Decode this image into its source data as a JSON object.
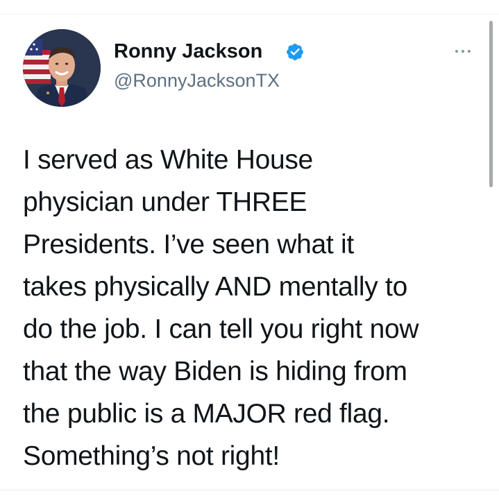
{
  "tweet": {
    "display_name": "Ronny Jackson",
    "handle": "@RonnyJacksonTX",
    "verified": true,
    "text": "I served as White House\nphysician under THREE\nPresidents. I’ve seen what it\ntakes physically AND mentally to\ndo the job. I can tell you right now\nthat the way Biden is hiding from\nthe public is a MAJOR red flag.\nSomething’s not right!"
  },
  "icons": {
    "verified": "verified-badge-icon",
    "more": "more-options-icon"
  },
  "colors": {
    "text": "#0f1419",
    "handle": "#5b7083",
    "verified": "#1d9bf0",
    "scrollbar": "#a7aaad"
  }
}
